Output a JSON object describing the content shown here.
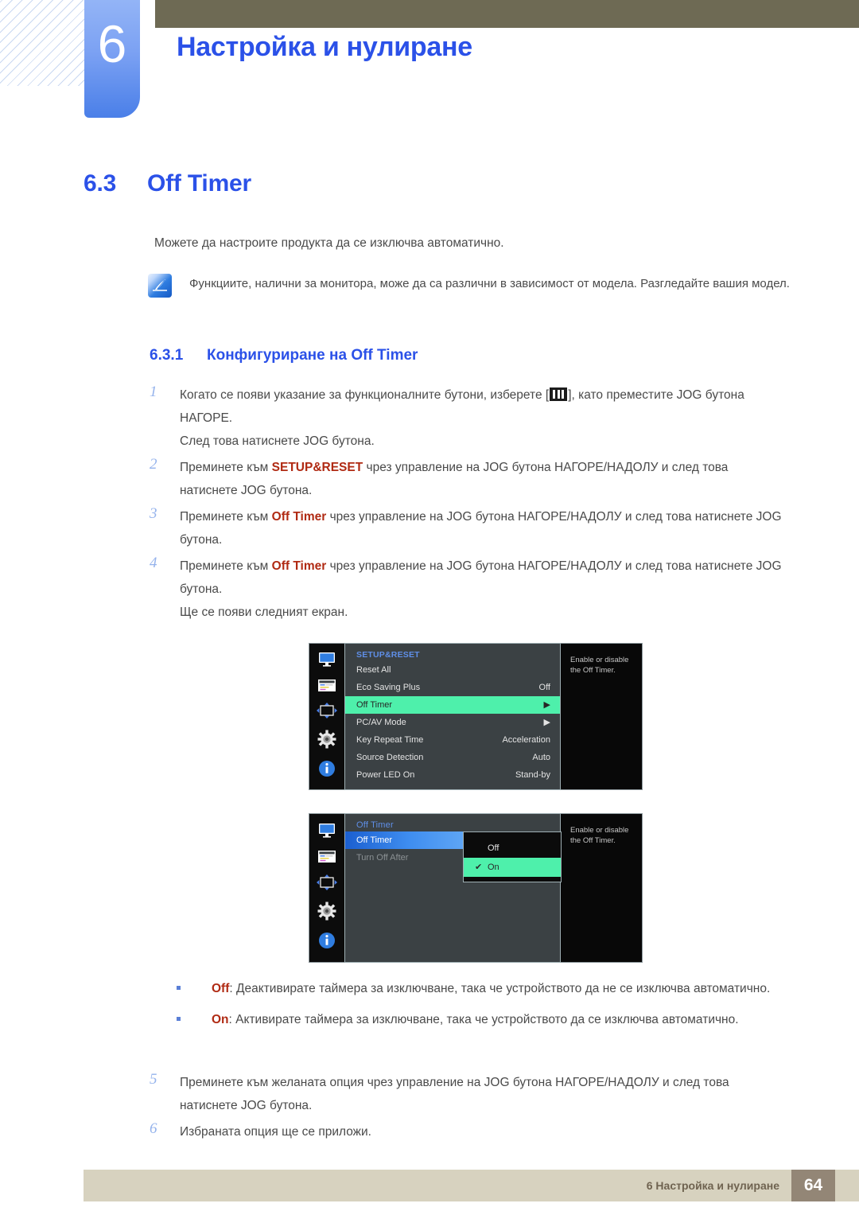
{
  "header": {
    "chapter_number": "6",
    "chapter_title": "Настройка и нулиране"
  },
  "section": {
    "number": "6.3",
    "title": "Off Timer",
    "intro": "Можете да настроите продукта да се изключва автоматично."
  },
  "note": {
    "icon": "note-pen-icon",
    "text": "Функциите, налични за монитора, може да са различни в зависимост от модела. Разгледайте вашия модел."
  },
  "subsection": {
    "number": "6.3.1",
    "title": "Конфигуриране на Off Timer"
  },
  "steps": [
    {
      "num": "1",
      "text_before": "Когато се появи указание за функционалните бутони, изберете [",
      "icon": "menu-bars-icon",
      "text_after": "], като преместите JOG бутона НАГОРЕ.",
      "extra": "След това натиснете JOG бутона."
    },
    {
      "num": "2",
      "text_before": "Преминете към ",
      "bold": "SETUP&RESET",
      "text_after": " чрез управление на JOG бутона НАГОРЕ/НАДОЛУ и след това натиснете JOG бутона."
    },
    {
      "num": "3",
      "text_before": "Преминете към ",
      "bold": "Off Timer",
      "text_after": " чрез управление на JOG бутона НАГОРЕ/НАДОЛУ и след това натиснете JOG бутона."
    },
    {
      "num": "4",
      "text_before": "Преминете към ",
      "bold": "Off Timer",
      "text_after": " чрез управление на JOG бутона НАГОРЕ/НАДОЛУ и след това натиснете JOG бутона.",
      "extra": "Ще се появи следният екран."
    }
  ],
  "steps_tail": [
    {
      "num": "5",
      "text": "Преминете към желаната опция чрез управление на JOG бутона НАГОРЕ/НАДОЛУ и след това натиснете JOG бутона."
    },
    {
      "num": "6",
      "text": "Избраната опция ще се приложи."
    }
  ],
  "bullets": [
    {
      "term": "Off",
      "text": ": Деактивирате таймера за изключване, така че устройството да не се изключва автоматично."
    },
    {
      "term": "On",
      "text": ": Активирате таймера за изключване, така че устройството да се изключва автоматично."
    }
  ],
  "osd1": {
    "icons": [
      "monitor-icon",
      "picture-settings-icon",
      "screen-adjust-icon",
      "gear-icon",
      "info-icon"
    ],
    "title": "SETUP&RESET",
    "rows": [
      {
        "label": "Reset All",
        "value": ""
      },
      {
        "label": "Eco Saving Plus",
        "value": "Off"
      },
      {
        "label": "Off Timer",
        "value": "▶",
        "selected": true
      },
      {
        "label": "PC/AV Mode",
        "value": "▶"
      },
      {
        "label": "Key Repeat Time",
        "value": "Acceleration"
      },
      {
        "label": "Source Detection",
        "value": "Auto"
      },
      {
        "label": "Power LED On",
        "value": "Stand-by"
      }
    ],
    "help": "Enable or disable the Off Timer."
  },
  "osd2": {
    "icons": [
      "monitor-icon",
      "picture-settings-icon",
      "screen-adjust-icon",
      "gear-icon",
      "info-icon"
    ],
    "title": "Off Timer",
    "rows": [
      {
        "label": "Off Timer",
        "selected": true
      },
      {
        "label": "Turn Off After",
        "dim": true
      }
    ],
    "popup": [
      {
        "label": "Off",
        "selected": false
      },
      {
        "label": "On",
        "selected": true,
        "check": "✔"
      }
    ],
    "help": "Enable or disable the Off Timer."
  },
  "footer": {
    "text": "6 Настройка и нулиране",
    "page": "64"
  },
  "colors": {
    "accent_blue": "#2b51e8",
    "highlight_red": "#b02a13",
    "osd_green": "#4ef0ab",
    "olive": "#6e6a54",
    "footer_beige": "#d7d2bf",
    "footer_brown": "#938676"
  }
}
